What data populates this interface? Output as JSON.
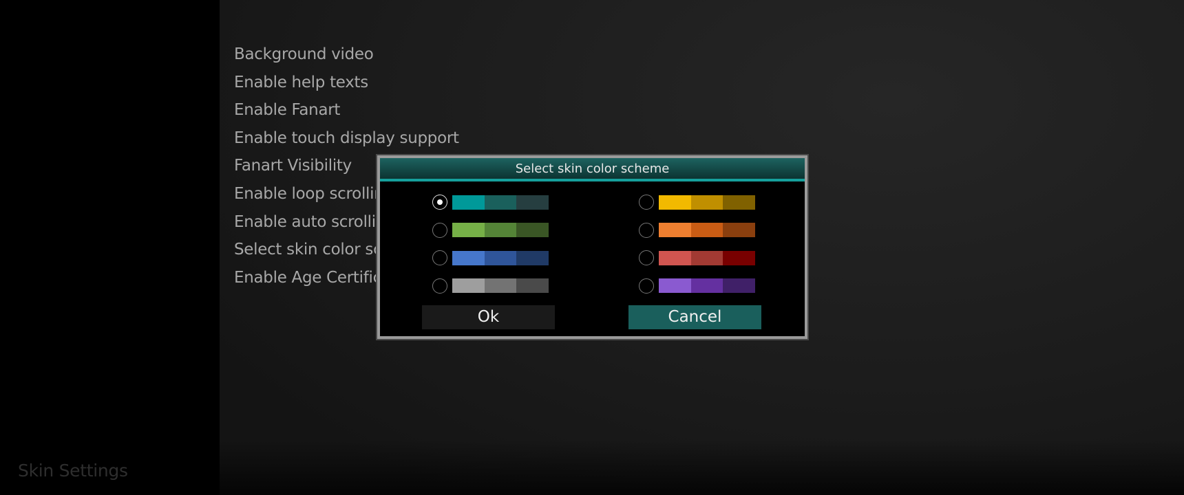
{
  "sidebar": {
    "title": "Skin Settings"
  },
  "menu": {
    "items": [
      "Background video",
      "Enable help texts",
      "Enable Fanart",
      "Enable touch display support",
      "Fanart Visibility",
      "Enable loop scrolling",
      "Enable auto scrolling",
      "Select skin color scheme",
      "Enable Age Certification"
    ]
  },
  "dialog": {
    "title": "Select skin color scheme",
    "selected_index": 0,
    "options": [
      {
        "colors": [
          "#009999",
          "#1a605c",
          "#263e40"
        ],
        "selected": true
      },
      {
        "colors": [
          "#76b047",
          "#548437",
          "#3a5625"
        ],
        "selected": false
      },
      {
        "colors": [
          "#4677cb",
          "#2f559a",
          "#203a66"
        ],
        "selected": false
      },
      {
        "colors": [
          "#9e9e9e",
          "#737373",
          "#4a4a4a"
        ],
        "selected": false
      },
      {
        "colors": [
          "#f2b900",
          "#c08f00",
          "#806100"
        ],
        "selected": false
      },
      {
        "colors": [
          "#ee7f30",
          "#c95c14",
          "#8a3f0e"
        ],
        "selected": false
      },
      {
        "colors": [
          "#d05550",
          "#a23a33",
          "#780000"
        ],
        "selected": false
      },
      {
        "colors": [
          "#8a5ad0",
          "#6430a0",
          "#402068"
        ],
        "selected": false
      }
    ],
    "ok_label": "Ok",
    "cancel_label": "Cancel",
    "accent": "#1a5f5c"
  }
}
